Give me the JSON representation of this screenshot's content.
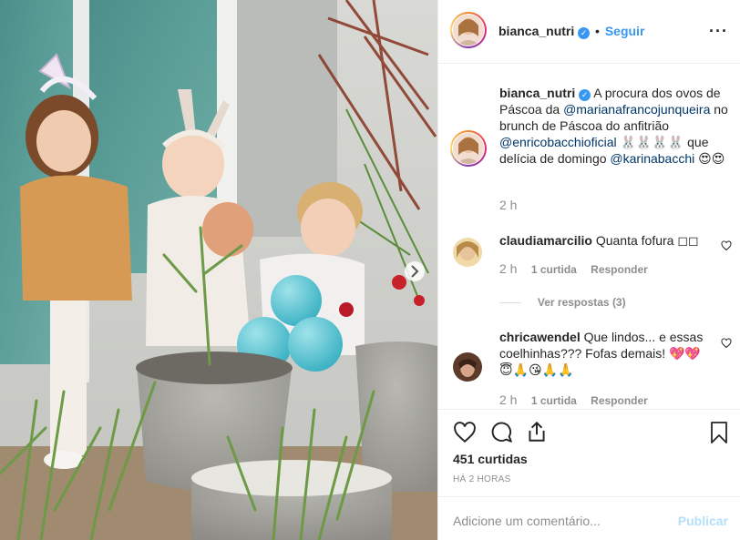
{
  "post": {
    "username": "bianca_nutri",
    "verified_mark": "✓",
    "follow_separator": "•",
    "follow_label": "Seguir",
    "more_icon": "more-dots-icon",
    "caption": {
      "text_1": "A procura dos ovos de Páscoa da",
      "mention_1": "@marianafrancojunqueira",
      "text_2": "no brunch de Páscoa do anfitrião",
      "mention_2": "@enricobacchioficial",
      "emoji_rabbits": "🐰🐰🐰🐰",
      "text_3": "que delícia de domingo",
      "mention_3": "@karinabacchi",
      "emoji_end": "😍😍",
      "time": "2 h"
    },
    "comments": [
      {
        "username": "claudiamarcilio",
        "text": "Quanta fofura",
        "emoji": "◻◻",
        "time": "2 h",
        "likes": "1 curtida",
        "reply": "Responder",
        "view_replies": "Ver respostas (3)"
      },
      {
        "username": "chricawendel",
        "text": "Que lindos... e essas coelhinhas??? Fofas demais!",
        "emoji": "💖💖😇🙏😘🙏🙏",
        "time": "2 h",
        "likes": "1 curtida",
        "reply": "Responder"
      }
    ],
    "likes": "451 curtidas",
    "posted_ago": "HÁ 2 HORAS",
    "add_comment_placeholder": "Adicione um comentário...",
    "publish_label": "Publicar"
  },
  "colors": {
    "link": "#3897f0",
    "mention": "#003569",
    "muted": "#8e8e8e",
    "publish_disabled": "#b2dffc"
  }
}
